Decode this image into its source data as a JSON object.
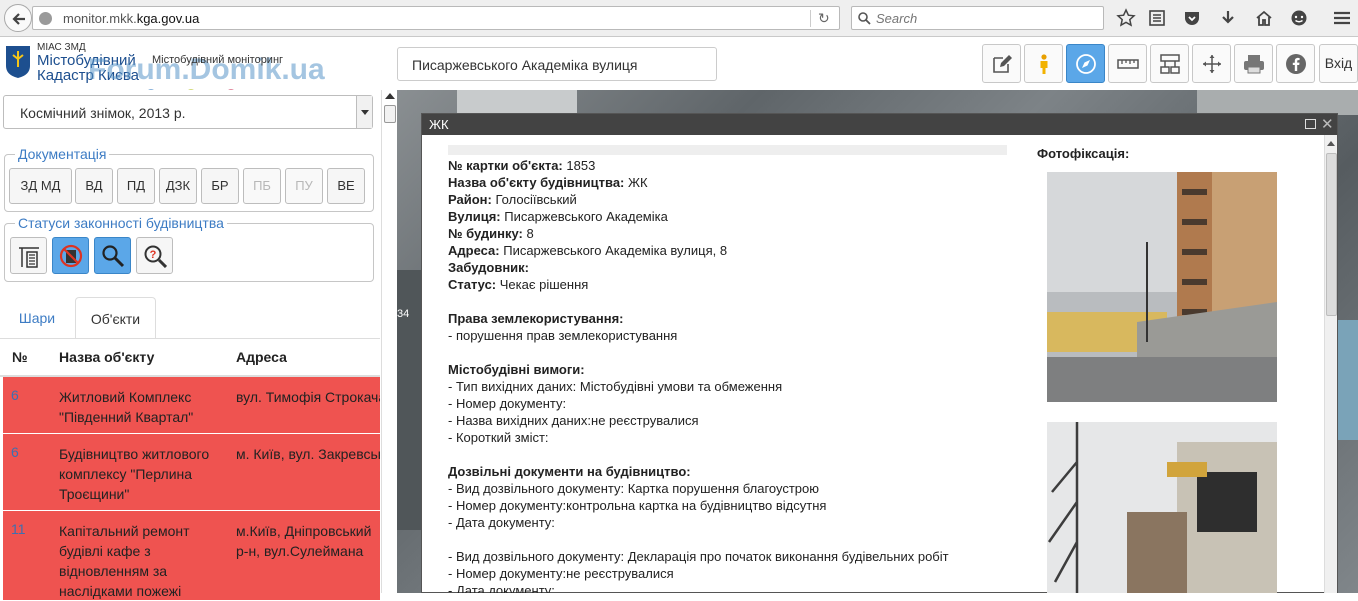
{
  "browser": {
    "url_prefix": "monitor.mkk.",
    "url_domain": "kga.gov.ua",
    "search_placeholder": "Search"
  },
  "header": {
    "logo_small": "МІАС ЗМД",
    "logo_line1": "Містобудівний",
    "logo_line2": "Кадастр Києва",
    "logo_subtitle": "Містобудівний моніторинг",
    "watermark": "Forum.Domik.ua",
    "address_value": "Писаржевського Академіка вулиця",
    "login_label": "Вхід",
    "toolbar_icons": [
      "edit-icon",
      "street-view-icon",
      "compass-icon",
      "ruler-icon",
      "layers-config-icon",
      "move-icon",
      "print-icon",
      "facebook-icon"
    ]
  },
  "sidebar": {
    "layer_selected": "Космічний знімок, 2013 р.",
    "docs_legend": "Документація",
    "doc_buttons": [
      {
        "label": "ЗД МД",
        "disabled": false
      },
      {
        "label": "ВД",
        "disabled": false
      },
      {
        "label": "ПД",
        "disabled": false
      },
      {
        "label": "ДЗК",
        "disabled": false
      },
      {
        "label": "БР",
        "disabled": false
      },
      {
        "label": "ПБ",
        "disabled": true
      },
      {
        "label": "ПУ",
        "disabled": true
      },
      {
        "label": "ВЕ",
        "disabled": false
      }
    ],
    "status_legend": "Статуси законності будівництва",
    "tabs": {
      "layers": "Шари",
      "objects": "Об'єкти"
    },
    "table": {
      "headers": [
        "№",
        "Назва об'єкту",
        "Адреса"
      ],
      "rows": [
        {
          "num": "6",
          "name": "Житловий Комплекс \"Південний Квартал\"",
          "address": "вул. Тимофія Строкача"
        },
        {
          "num": "6",
          "name": "Будівництво житлового комплексу \"Перлина Троєщини\"",
          "address": "м. Київ, вул. Закревського"
        },
        {
          "num": "11",
          "name": "Капітальний ремонт будівлі кафе з відновленням за наслідками пожежі",
          "address": "м.Київ, Дніпровський р-н, вул.Сулеймана Стальського"
        }
      ]
    }
  },
  "popup": {
    "title": "ЖК",
    "photo_title": "Фотофіксація:",
    "lines": [
      {
        "label": "№ картки об'єкта:",
        "value": "1853"
      },
      {
        "label": "Назва об'єкту будівництва:",
        "value": "ЖК"
      },
      {
        "label": "Район:",
        "value": "Голосіївський"
      },
      {
        "label": "Вулиця:",
        "value": "Писаржевського Академіка"
      },
      {
        "label": "№ будинку:",
        "value": "8"
      },
      {
        "label": "Адреса:",
        "value": "Писаржевського Академіка вулиця, 8"
      },
      {
        "label": "Забудовник:",
        "value": ""
      },
      {
        "label": "Статус:",
        "value": "Чекає рішення"
      },
      {
        "label": "",
        "value": ""
      },
      {
        "label": "Права землекористування:",
        "value": ""
      },
      {
        "label": "",
        "value": "- порушення прав землекористування"
      },
      {
        "label": "",
        "value": ""
      },
      {
        "label": "Містобудівні вимоги:",
        "value": ""
      },
      {
        "label": "",
        "value": "- Тип вихідних даних: Містобудівні умови та обмеження"
      },
      {
        "label": "",
        "value": "- Номер документу:"
      },
      {
        "label": "",
        "value": "- Назва вихідних даних:не реєструвалися"
      },
      {
        "label": "",
        "value": "- Короткий зміст:"
      },
      {
        "label": "",
        "value": ""
      },
      {
        "label": "Дозвільні документи на будівництво:",
        "value": ""
      },
      {
        "label": "",
        "value": "- Вид дозвільного документу: Картка порушення благоустрою"
      },
      {
        "label": "",
        "value": "- Номер документу:контрольна картка на будівництво відсутня"
      },
      {
        "label": "",
        "value": "- Дата документу:"
      },
      {
        "label": "",
        "value": ""
      },
      {
        "label": "",
        "value": "- Вид дозвільного документу: Декларація про початок виконання будівельних робіт"
      },
      {
        "label": "",
        "value": "- Номер документу:не реєструвалися"
      },
      {
        "label": "",
        "value": "- Дата документу:"
      }
    ]
  },
  "map": {
    "edge_label": "34"
  },
  "colors": {
    "row_highlight": "#ef5350",
    "accent_blue": "#5ba7e8",
    "link_blue": "#3d7cc4"
  }
}
